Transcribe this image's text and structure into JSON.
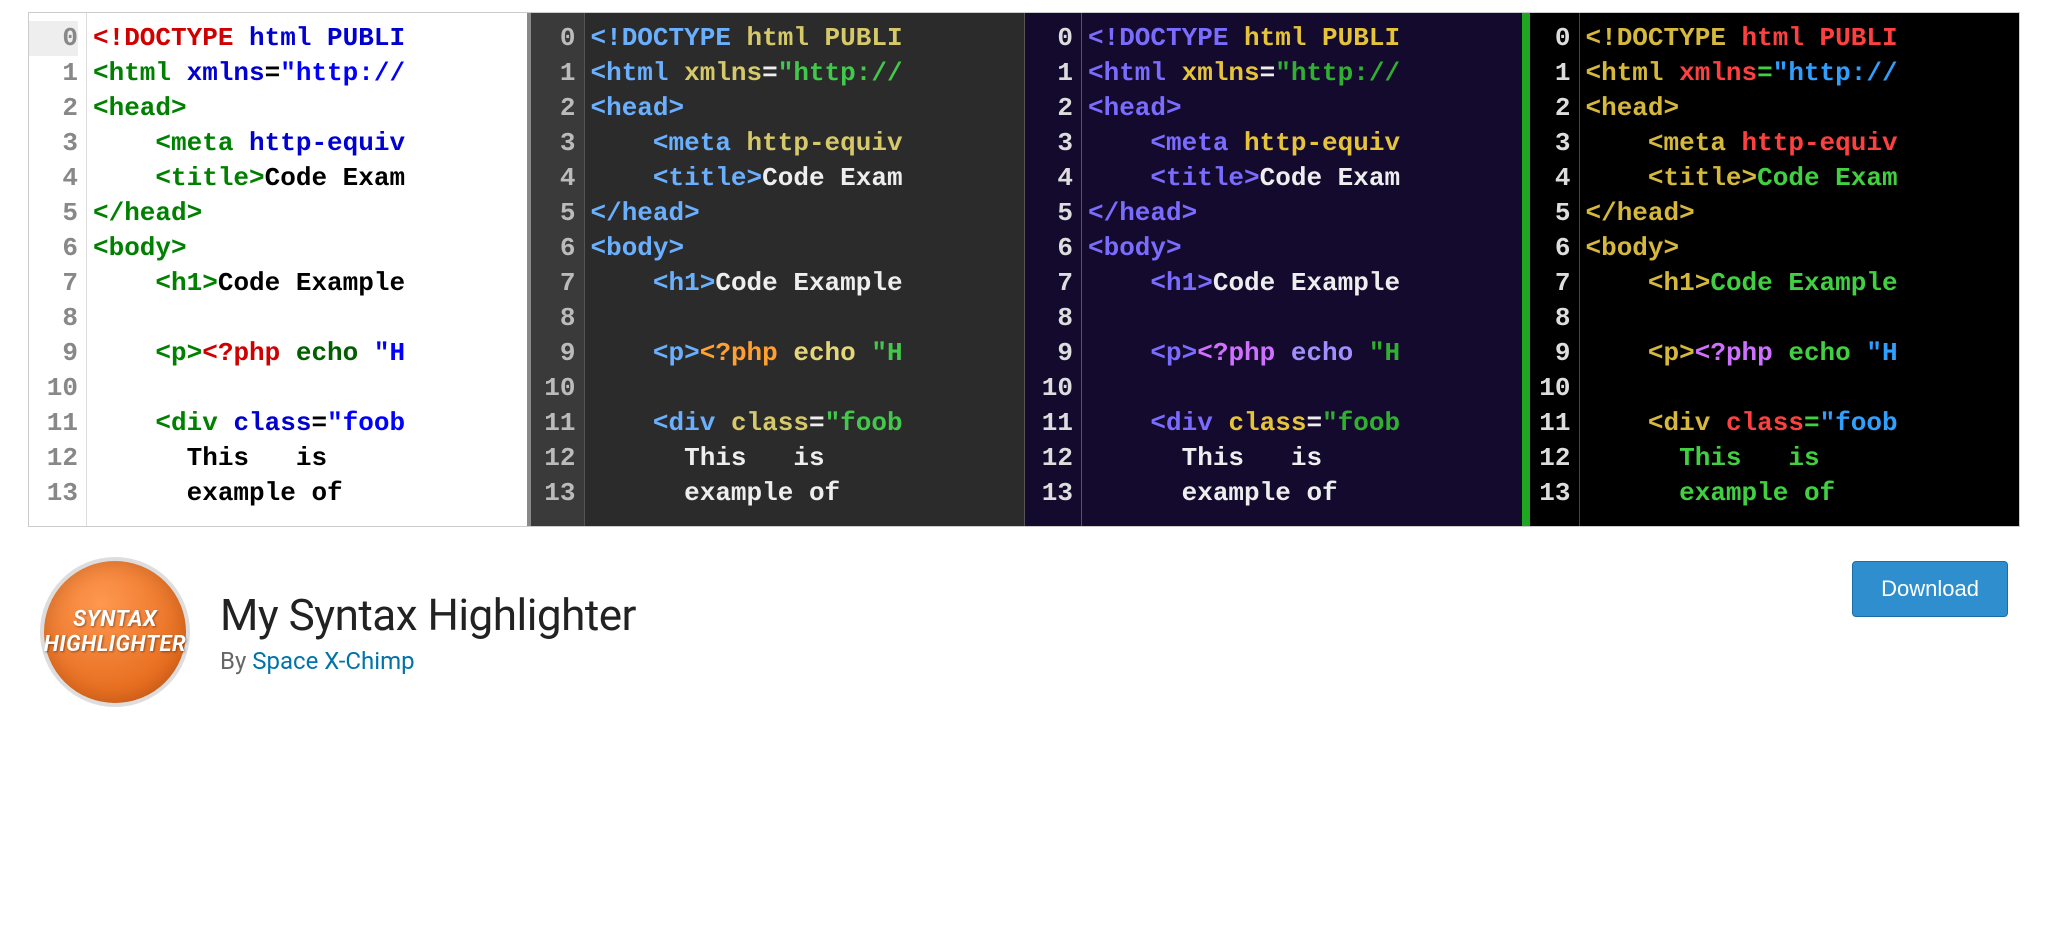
{
  "plugin": {
    "title": "My Syntax Highlighter",
    "by_prefix": "By ",
    "author": "Space X-Chimp",
    "download_label": "Download",
    "logo_line1": "SYNTAX",
    "logo_line2": "HIGHLIGHTER"
  },
  "line_numbers": [
    "0",
    "1",
    "2",
    "3",
    "4",
    "5",
    "6",
    "7",
    "8",
    "9",
    "10",
    "11",
    "12",
    "13"
  ],
  "code_lines": [
    {
      "type": "doctype"
    },
    {
      "type": "html-open"
    },
    {
      "type": "head-open"
    },
    {
      "type": "meta"
    },
    {
      "type": "title"
    },
    {
      "type": "head-close"
    },
    {
      "type": "body-open"
    },
    {
      "type": "h1"
    },
    {
      "type": "blank"
    },
    {
      "type": "php"
    },
    {
      "type": "blank"
    },
    {
      "type": "div"
    },
    {
      "type": "this-is"
    },
    {
      "type": "example-of"
    }
  ],
  "tokens": {
    "doctype_open": "<!DOCTYPE",
    "doctype_rest": " html PUBLI",
    "html_open": "<html",
    "xmlns_attr": " xmlns",
    "eq": "=",
    "http_str": "\"http://",
    "head_open": "<head>",
    "meta_open": "<meta",
    "http_equiv": " http-equiv",
    "title_open": "<title>",
    "title_text": "Code Exam",
    "head_close": "</head>",
    "body_open": "<body>",
    "h1_open": "<h1>",
    "h1_text": "Code Example",
    "p_open": "<p>",
    "php_open": "<?php",
    "php_echo": " echo ",
    "php_str": "\"H",
    "div_open": "<div",
    "class_attr": " class",
    "foob_str": "\"foob",
    "this": "This",
    "is": "is",
    "example_of": "example of"
  },
  "themes": [
    {
      "id": "light",
      "colors": {
        "doctype": "#d00000",
        "tag": "#008000",
        "attr": "#0000d0",
        "str": "#0000ff",
        "text": "#000",
        "php": "#d00000",
        "php_kw": "#006000"
      }
    },
    {
      "id": "dark",
      "colors": {
        "doctype": "#6ab0ff",
        "tag": "#6ab0ff",
        "attr": "#d6c96a",
        "str": "#42c84a",
        "text": "#eee",
        "php": "#ffa030",
        "php_kw": "#e6d67a"
      }
    },
    {
      "id": "purple",
      "colors": {
        "doctype": "#7a6cff",
        "tag": "#7a6cff",
        "attr": "#e6c43a",
        "str": "#30b030",
        "text": "#eee",
        "php": "#d070ff",
        "php_kw": "#a090ff"
      }
    },
    {
      "id": "black",
      "colors": {
        "doctype": "#d6b83a",
        "tag": "#d6b83a",
        "attr": "#ff4040",
        "str": "#30a0ff",
        "text": "#40d040",
        "php": "#d070ff",
        "php_kw": "#40d040"
      }
    }
  ]
}
